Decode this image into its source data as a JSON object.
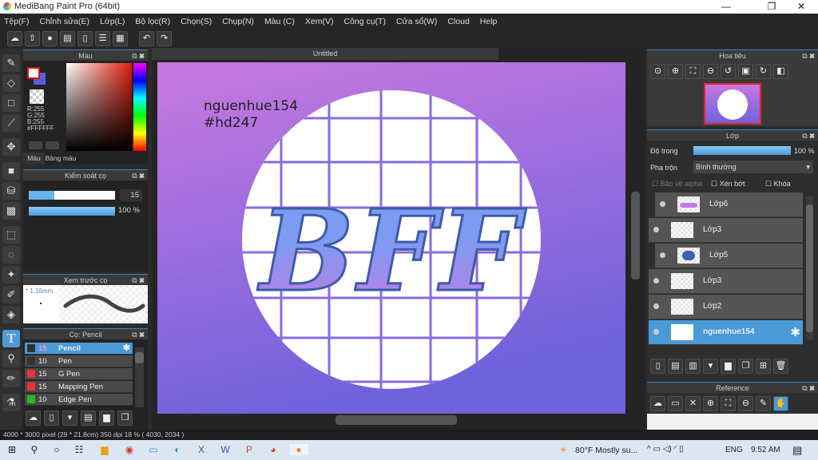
{
  "window": {
    "title": "MediBang Paint Pro (64bit)",
    "minimize": "—",
    "maximize": "❐",
    "close": "✕"
  },
  "menu": [
    "Tệp(F)",
    "Chỉnh sửa(E)",
    "Lớp(L)",
    "Bộ lọc(R)",
    "Chọn(S)",
    "Chụp(N)",
    "Màu (C)",
    "Xem(V)",
    "Công cụ(T)",
    "Cửa sổ(W)",
    "Cloud",
    "Help"
  ],
  "color_panel": {
    "title": "Màu",
    "r": "R:255",
    "g": "G:255",
    "b": "B:255",
    "hex": "#FFFFFF",
    "tabs": [
      "Màu",
      "Bảng màu"
    ],
    "primary": "#FFFFFF",
    "secondary": "#6a5ae0"
  },
  "brush_control": {
    "title": "Kiểm soát cọ",
    "size": "15",
    "opacity": "100 %",
    "size_fraction": 0.3,
    "opacity_fraction": 1.0
  },
  "brush_preview": {
    "title": "Xem trước cọ",
    "size": "* 1.16mm"
  },
  "brush_list": {
    "title": "Cọ: Pencil",
    "items": [
      {
        "size": "15",
        "name": "Pencil",
        "color": "#333333",
        "selected": true
      },
      {
        "size": "10",
        "name": "Pen",
        "color": "#333333"
      },
      {
        "size": "15",
        "name": "G Pen",
        "color": "#ee3333"
      },
      {
        "size": "15",
        "name": "Mapping Pen",
        "color": "#ee3333"
      },
      {
        "size": "10",
        "name": "Edge Pen",
        "color": "#22bb22"
      }
    ]
  },
  "canvas": {
    "tab": "Untitled",
    "text_line1": "nguenhue154",
    "text_line2": "#hd247",
    "art_text": "BFF"
  },
  "navigator": {
    "title": "Hoa tiêu"
  },
  "layers": {
    "title": "Lớp",
    "opacity_label": "Độ trong",
    "opacity": "100 %",
    "blend_label": "Pha trộn",
    "blend": "Bình thường",
    "protect_alpha": "Bảo vệ alpha",
    "clip": "Xén bớt",
    "lock": "Khóa",
    "items": [
      {
        "name": "Lớp6",
        "clipped": true
      },
      {
        "name": "Lớp3"
      },
      {
        "name": "Lớp5",
        "clipped": true
      },
      {
        "name": "Lớp3"
      },
      {
        "name": "Lớp2"
      },
      {
        "name": "nguenhue154",
        "selected": true
      }
    ]
  },
  "reference": {
    "title": "Reference"
  },
  "status": "4000 * 3000 pixel   (29 * 21.8cm)   350 dpi   18 %   ( 4030, 2034 )",
  "taskbar": {
    "weather": "80°F  Mostly su...",
    "lang": "ENG",
    "time": "9:52 AM"
  }
}
